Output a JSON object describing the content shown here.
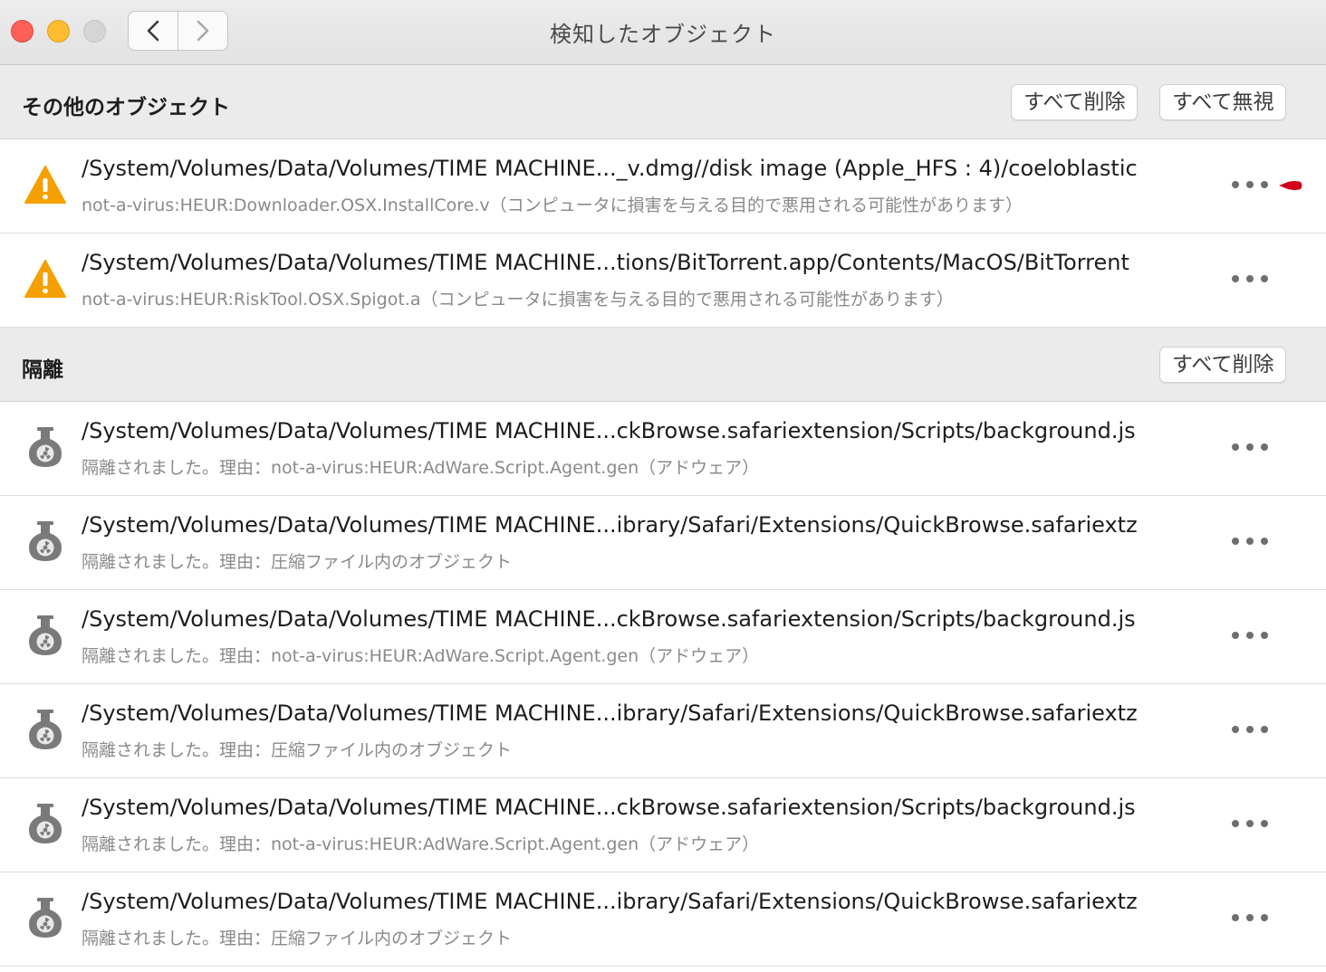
{
  "window": {
    "title": "検知したオブジェクト"
  },
  "sections": {
    "other": {
      "title": "その他のオブジェクト",
      "delete_all": "すべて削除",
      "ignore_all": "すべて無視"
    },
    "quarantine": {
      "title": "隔離",
      "delete_all": "すべて削除"
    }
  },
  "other_items": [
    {
      "path": "/System/Volumes/Data/Volumes/TIME MACHINE..._v.dmg//disk image (Apple_HFS : 4)/coeloblastic",
      "desc": "not-a-virus:HEUR:Downloader.OSX.InstallCore.v（コンピュータに損害を与える目的で悪用される可能性があります）",
      "icon": "warning-triangle-icon"
    },
    {
      "path": "/System/Volumes/Data/Volumes/TIME MACHINE...tions/BitTorrent.app/Contents/MacOS/BitTorrent",
      "desc": "not-a-virus:HEUR:RiskTool.OSX.Spigot.a（コンピュータに損害を与える目的で悪用される可能性があります）",
      "icon": "warning-triangle-icon"
    }
  ],
  "quarantine_items": [
    {
      "path": "/System/Volumes/Data/Volumes/TIME MACHINE...ckBrowse.safariextension/Scripts/background.js",
      "desc": "隔離されました。理由：not-a-virus:HEUR:AdWare.Script.Agent.gen（アドウェア）",
      "icon": "biohazard-flask-icon"
    },
    {
      "path": "/System/Volumes/Data/Volumes/TIME MACHINE...ibrary/Safari/Extensions/QuickBrowse.safariextz",
      "desc": "隔離されました。理由：圧縮ファイル内のオブジェクト",
      "icon": "biohazard-flask-icon"
    },
    {
      "path": "/System/Volumes/Data/Volumes/TIME MACHINE...ckBrowse.safariextension/Scripts/background.js",
      "desc": "隔離されました。理由：not-a-virus:HEUR:AdWare.Script.Agent.gen（アドウェア）",
      "icon": "biohazard-flask-icon"
    },
    {
      "path": "/System/Volumes/Data/Volumes/TIME MACHINE...ibrary/Safari/Extensions/QuickBrowse.safariextz",
      "desc": "隔離されました。理由：圧縮ファイル内のオブジェクト",
      "icon": "biohazard-flask-icon"
    },
    {
      "path": "/System/Volumes/Data/Volumes/TIME MACHINE...ckBrowse.safariextension/Scripts/background.js",
      "desc": "隔離されました。理由：not-a-virus:HEUR:AdWare.Script.Agent.gen（アドウェア）",
      "icon": "biohazard-flask-icon"
    },
    {
      "path": "/System/Volumes/Data/Volumes/TIME MACHINE...ibrary/Safari/Extensions/QuickBrowse.safariextz",
      "desc": "隔離されました。理由：圧縮ファイル内のオブジェクト",
      "icon": "biohazard-flask-icon"
    }
  ],
  "colors": {
    "warning": "#f5a000",
    "quarantine_icon": "#7a7a7a",
    "pointer": "#d0021b"
  }
}
